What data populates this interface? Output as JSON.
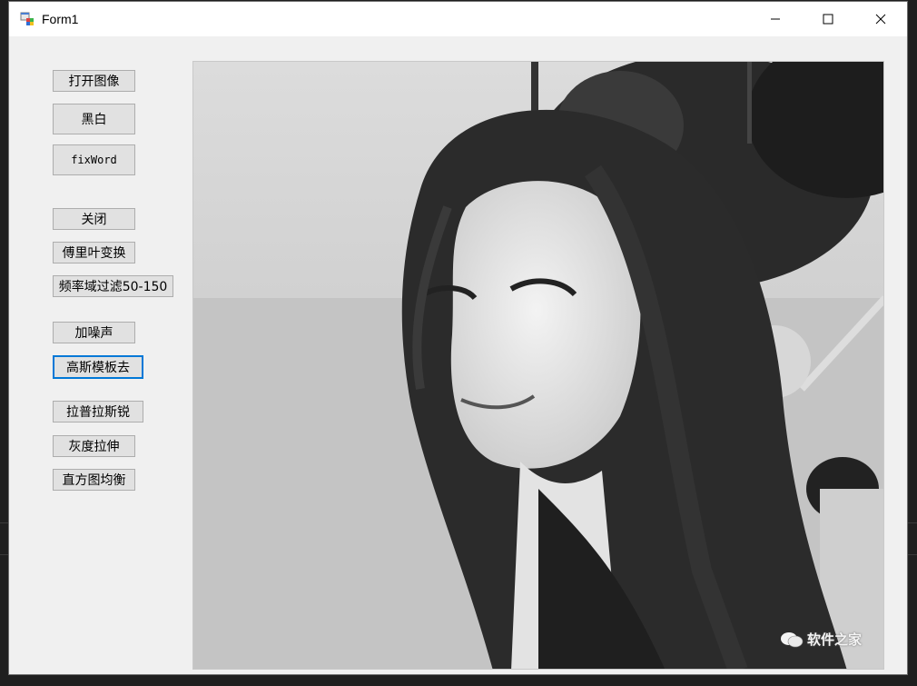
{
  "window": {
    "title": "Form1"
  },
  "buttons": {
    "open_image": "打开图像",
    "black_white": "黑白",
    "fixword": "fixWord",
    "close": "关闭",
    "fourier": "傅里叶变换",
    "freq_filter": "频率域过滤50-150",
    "add_noise": "加噪声",
    "gaussian": "高斯模板去",
    "laplacian": "拉普拉斯锐",
    "gray_stretch": "灰度拉伸",
    "histogram": "直方图均衡"
  },
  "image": {
    "watermark": "软件之家"
  },
  "colors": {
    "focus_border": "#0078d7",
    "button_face": "#e1e1e1",
    "window_bg": "#f0f0f0"
  },
  "icons": [
    "app-icon",
    "minimize-icon",
    "maximize-icon",
    "close-icon",
    "wechat-icon"
  ]
}
